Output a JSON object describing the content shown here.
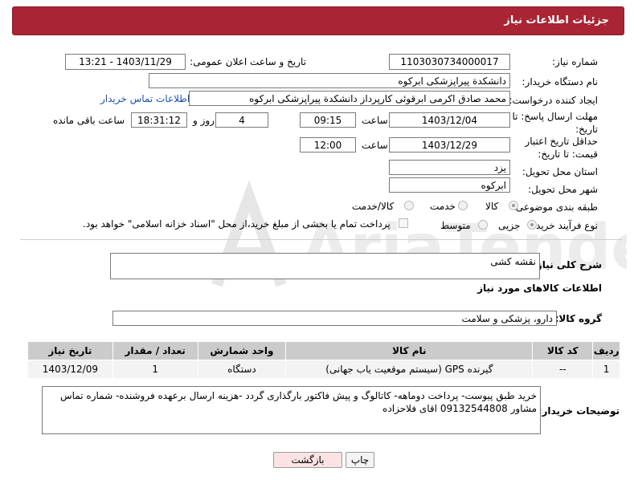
{
  "header": {
    "title": "جزئیات اطلاعات نیاز"
  },
  "fields": {
    "need_number": {
      "label": "شماره نیاز:",
      "value": "1103030734000017"
    },
    "announce_datetime": {
      "label": "تاریخ و ساعت اعلان عمومی:",
      "value": "1403/11/29 - 13:21"
    },
    "buyer_org": {
      "label": "نام دستگاه خریدار:",
      "value": "دانشکدة پیراپزشکی ابرکوه"
    },
    "creator": {
      "label": "ایجاد کننده درخواست:",
      "value": "محمد صادق اکرمی ابرقوئی کارپرداز دانشکدة پیراپزشکی ابرکوه",
      "contact_link": "اطلاعات تماس خریدار"
    },
    "response_deadline": {
      "label": "مهلت ارسال پاسخ: تا تاریخ:",
      "date": "1403/12/04",
      "time_label": "ساعت",
      "time": "09:15",
      "days": "4",
      "days_label": "روز و",
      "remaining": "18:31:12",
      "remaining_label": "ساعت باقی مانده"
    },
    "price_validity": {
      "label": "حداقل تاریخ اعتبار قیمت: تا تاریخ:",
      "date": "1403/12/29",
      "time_label": "ساعت",
      "time": "12:00"
    },
    "province": {
      "label": "استان محل تحویل:",
      "value": "یزد"
    },
    "city": {
      "label": "شهر محل تحویل:",
      "value": "ابرکوه"
    },
    "category": {
      "label": "طبقه بندی موضوعی:",
      "options": [
        "کالا",
        "خدمت",
        "کالا/خدمت"
      ],
      "selected": 0
    },
    "process": {
      "label": "نوع فرآیند خرید :",
      "options": [
        "جزیی",
        "متوسط"
      ],
      "selected": 0,
      "note": "پرداخت تمام یا بخشی از مبلغ خرید،از محل \"اسناد خزانه اسلامی\" خواهد بود."
    }
  },
  "summary": {
    "label": "شرح کلی نیاز:",
    "value": "نقشه کشی"
  },
  "goods_section": {
    "title": "اطلاعات کالاهای مورد نیاز"
  },
  "goods_group": {
    "label": "گروه کالا:",
    "value": "دارو، پزشکی و سلامت"
  },
  "table": {
    "columns": [
      "ردیف",
      "کد کالا",
      "نام کالا",
      "واحد شمارش",
      "تعداد / مقدار",
      "تاریخ نیاز"
    ],
    "rows": [
      [
        "1",
        "--",
        "گیرنده GPS (سیستم موقعیت یاب جهانی)",
        "دستگاه",
        "1",
        "1403/12/09"
      ]
    ]
  },
  "buyer_notes": {
    "label": "توضیحات خریدار:",
    "value": "خرید طبق پیوست- پرداخت دوماهه- کاتالوگ و پیش فاکتور بارگذاری گردد -هزینه ارسال برعهده فروشنده- شماره تماس مشاور 09132544808 اقای فلاحزاده"
  },
  "buttons": {
    "print": "چاپ",
    "back": "بازگشت"
  },
  "watermark": {
    "text": "AriaTender.net"
  },
  "colors": {
    "header": "#a92434",
    "back_button": "#fbe3e3",
    "link": "#1a4fb5"
  }
}
